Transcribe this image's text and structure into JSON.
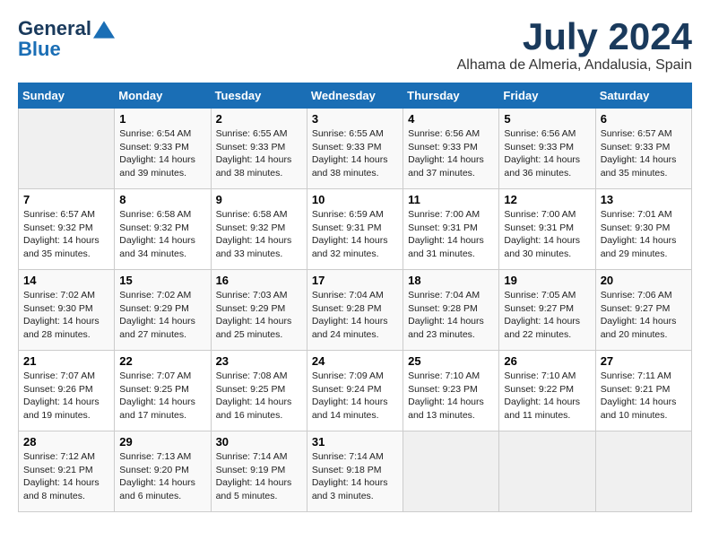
{
  "logo": {
    "line1": "General",
    "line2": "Blue"
  },
  "title": "July 2024",
  "location": "Alhama de Almeria, Andalusia, Spain",
  "days_of_week": [
    "Sunday",
    "Monday",
    "Tuesday",
    "Wednesday",
    "Thursday",
    "Friday",
    "Saturday"
  ],
  "weeks": [
    [
      {
        "day": "",
        "info": ""
      },
      {
        "day": "1",
        "info": "Sunrise: 6:54 AM\nSunset: 9:33 PM\nDaylight: 14 hours\nand 39 minutes."
      },
      {
        "day": "2",
        "info": "Sunrise: 6:55 AM\nSunset: 9:33 PM\nDaylight: 14 hours\nand 38 minutes."
      },
      {
        "day": "3",
        "info": "Sunrise: 6:55 AM\nSunset: 9:33 PM\nDaylight: 14 hours\nand 38 minutes."
      },
      {
        "day": "4",
        "info": "Sunrise: 6:56 AM\nSunset: 9:33 PM\nDaylight: 14 hours\nand 37 minutes."
      },
      {
        "day": "5",
        "info": "Sunrise: 6:56 AM\nSunset: 9:33 PM\nDaylight: 14 hours\nand 36 minutes."
      },
      {
        "day": "6",
        "info": "Sunrise: 6:57 AM\nSunset: 9:33 PM\nDaylight: 14 hours\nand 35 minutes."
      }
    ],
    [
      {
        "day": "7",
        "info": "Sunrise: 6:57 AM\nSunset: 9:32 PM\nDaylight: 14 hours\nand 35 minutes."
      },
      {
        "day": "8",
        "info": "Sunrise: 6:58 AM\nSunset: 9:32 PM\nDaylight: 14 hours\nand 34 minutes."
      },
      {
        "day": "9",
        "info": "Sunrise: 6:58 AM\nSunset: 9:32 PM\nDaylight: 14 hours\nand 33 minutes."
      },
      {
        "day": "10",
        "info": "Sunrise: 6:59 AM\nSunset: 9:31 PM\nDaylight: 14 hours\nand 32 minutes."
      },
      {
        "day": "11",
        "info": "Sunrise: 7:00 AM\nSunset: 9:31 PM\nDaylight: 14 hours\nand 31 minutes."
      },
      {
        "day": "12",
        "info": "Sunrise: 7:00 AM\nSunset: 9:31 PM\nDaylight: 14 hours\nand 30 minutes."
      },
      {
        "day": "13",
        "info": "Sunrise: 7:01 AM\nSunset: 9:30 PM\nDaylight: 14 hours\nand 29 minutes."
      }
    ],
    [
      {
        "day": "14",
        "info": "Sunrise: 7:02 AM\nSunset: 9:30 PM\nDaylight: 14 hours\nand 28 minutes."
      },
      {
        "day": "15",
        "info": "Sunrise: 7:02 AM\nSunset: 9:29 PM\nDaylight: 14 hours\nand 27 minutes."
      },
      {
        "day": "16",
        "info": "Sunrise: 7:03 AM\nSunset: 9:29 PM\nDaylight: 14 hours\nand 25 minutes."
      },
      {
        "day": "17",
        "info": "Sunrise: 7:04 AM\nSunset: 9:28 PM\nDaylight: 14 hours\nand 24 minutes."
      },
      {
        "day": "18",
        "info": "Sunrise: 7:04 AM\nSunset: 9:28 PM\nDaylight: 14 hours\nand 23 minutes."
      },
      {
        "day": "19",
        "info": "Sunrise: 7:05 AM\nSunset: 9:27 PM\nDaylight: 14 hours\nand 22 minutes."
      },
      {
        "day": "20",
        "info": "Sunrise: 7:06 AM\nSunset: 9:27 PM\nDaylight: 14 hours\nand 20 minutes."
      }
    ],
    [
      {
        "day": "21",
        "info": "Sunrise: 7:07 AM\nSunset: 9:26 PM\nDaylight: 14 hours\nand 19 minutes."
      },
      {
        "day": "22",
        "info": "Sunrise: 7:07 AM\nSunset: 9:25 PM\nDaylight: 14 hours\nand 17 minutes."
      },
      {
        "day": "23",
        "info": "Sunrise: 7:08 AM\nSunset: 9:25 PM\nDaylight: 14 hours\nand 16 minutes."
      },
      {
        "day": "24",
        "info": "Sunrise: 7:09 AM\nSunset: 9:24 PM\nDaylight: 14 hours\nand 14 minutes."
      },
      {
        "day": "25",
        "info": "Sunrise: 7:10 AM\nSunset: 9:23 PM\nDaylight: 14 hours\nand 13 minutes."
      },
      {
        "day": "26",
        "info": "Sunrise: 7:10 AM\nSunset: 9:22 PM\nDaylight: 14 hours\nand 11 minutes."
      },
      {
        "day": "27",
        "info": "Sunrise: 7:11 AM\nSunset: 9:21 PM\nDaylight: 14 hours\nand 10 minutes."
      }
    ],
    [
      {
        "day": "28",
        "info": "Sunrise: 7:12 AM\nSunset: 9:21 PM\nDaylight: 14 hours\nand 8 minutes."
      },
      {
        "day": "29",
        "info": "Sunrise: 7:13 AM\nSunset: 9:20 PM\nDaylight: 14 hours\nand 6 minutes."
      },
      {
        "day": "30",
        "info": "Sunrise: 7:14 AM\nSunset: 9:19 PM\nDaylight: 14 hours\nand 5 minutes."
      },
      {
        "day": "31",
        "info": "Sunrise: 7:14 AM\nSunset: 9:18 PM\nDaylight: 14 hours\nand 3 minutes."
      },
      {
        "day": "",
        "info": ""
      },
      {
        "day": "",
        "info": ""
      },
      {
        "day": "",
        "info": ""
      }
    ]
  ]
}
